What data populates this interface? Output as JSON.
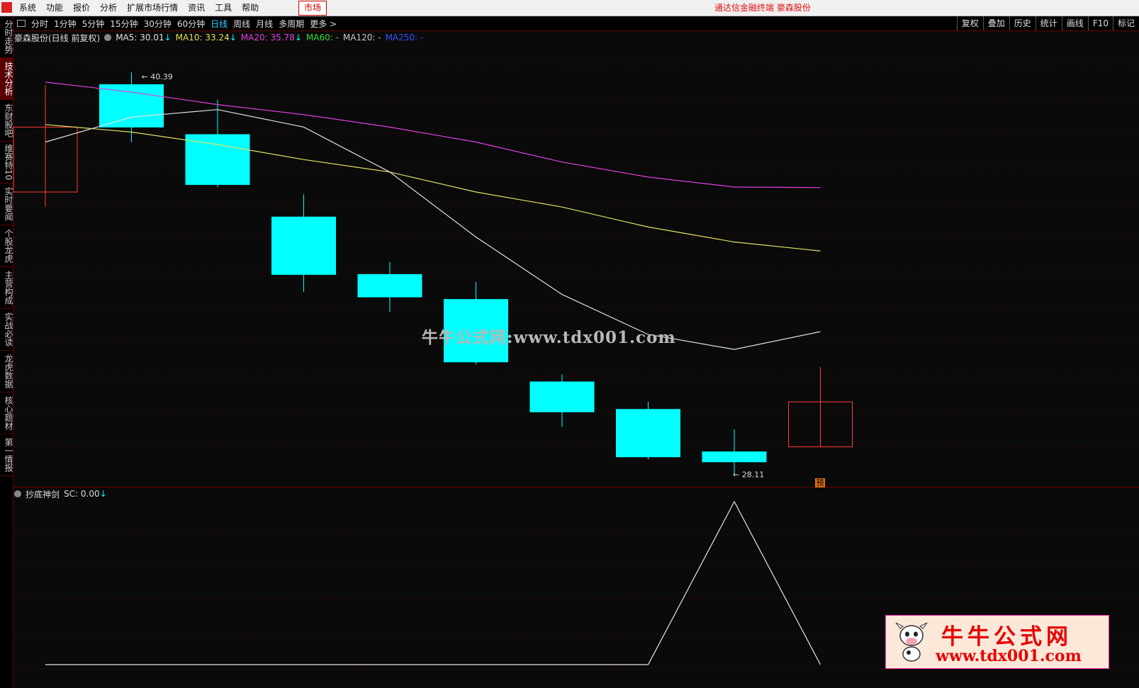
{
  "menubar": {
    "items": [
      "系统",
      "功能",
      "报价",
      "分析",
      "扩展市场行情",
      "资讯",
      "工具",
      "帮助"
    ],
    "market_button": "市场",
    "title": "通达信金融终端  豪森股份"
  },
  "toolbar": {
    "periods": [
      "分时",
      "1分钟",
      "5分钟",
      "15分钟",
      "30分钟",
      "60分钟",
      "日线",
      "周线",
      "月线",
      "多周期",
      "更多 >"
    ],
    "active_period": "日线",
    "right_tools": [
      "复权",
      "叠加",
      "历史",
      "统计",
      "画线",
      "F10",
      "标记"
    ]
  },
  "sidebar": {
    "tabs": [
      "分时走势",
      "技术分析",
      "东财股吧",
      "维赛特10",
      "实时要闻",
      "个股龙虎",
      "主营构成",
      "实战必读",
      "龙虎数据",
      "核心题材",
      "第一情报"
    ],
    "active_tab": "技术分析"
  },
  "chart_header": {
    "stock_name": "豪森股份(日线 前复权)",
    "ma5": "MA5: 30.01",
    "ma10": "MA10: 33.24",
    "ma20": "MA20: 35.78",
    "ma60": "MA60: -",
    "ma120": "MA120: -",
    "ma250": "MA250: -",
    "down_arrow": "↓"
  },
  "colors": {
    "up": "#ff3c3c",
    "down": "#00ffff",
    "ma5": "#e0e0e0",
    "ma10": "#e0e060",
    "ma20": "#e040e0",
    "ma60": "#30e030",
    "ma120": "#c8c8c8",
    "ma250": "#3050ff"
  },
  "chart_data": {
    "type": "candlestick",
    "high_label": "40.39",
    "low_label": "28.11",
    "candles": [
      {
        "open": 35.6,
        "close": 38.2,
        "high": 39.9,
        "low": 35.0
      },
      {
        "open": 39.9,
        "close": 38.2,
        "high": 40.39,
        "low": 37.6
      },
      {
        "open": 37.9,
        "close": 35.9,
        "high": 39.3,
        "low": 35.8
      },
      {
        "open": 34.6,
        "close": 32.3,
        "high": 35.5,
        "low": 31.6
      },
      {
        "open": 32.3,
        "close": 31.4,
        "high": 32.8,
        "low": 30.8
      },
      {
        "open": 31.3,
        "close": 28.8,
        "high": 32.0,
        "low": 28.7
      },
      {
        "open": 28.0,
        "close": 26.8,
        "high": 28.3,
        "low": 26.2
      },
      {
        "open": 26.9,
        "close": 25.0,
        "high": 27.2,
        "low": 24.9
      },
      {
        "open": 25.2,
        "close": 24.8,
        "high": 26.1,
        "low": 24.3
      },
      {
        "open": 25.4,
        "close": 27.2,
        "high": 28.6,
        "low": 25.4
      }
    ],
    "ma5": [
      37.6,
      38.6,
      38.9,
      38.2,
      36.4,
      33.8,
      31.5,
      29.9,
      29.3,
      30.01
    ],
    "ma10": [
      38.3,
      38.0,
      37.5,
      36.9,
      36.4,
      35.6,
      35.0,
      34.2,
      33.6,
      33.24
    ],
    "ma20": [
      40.0,
      39.6,
      39.1,
      38.7,
      38.2,
      37.6,
      36.8,
      36.2,
      35.8,
      35.78
    ],
    "y_range": [
      24.0,
      41.5
    ],
    "indicator": {
      "name": "抄底神剑",
      "value_label": "SC: 0.00",
      "values": [
        0,
        0,
        0,
        0,
        0,
        0,
        0,
        0,
        1,
        0
      ]
    }
  },
  "watermark": "牛牛公式网:www.tdx001.com",
  "logo": {
    "title": "牛牛公式网",
    "url": "www.tdx001.com"
  },
  "pre_badge": "预"
}
